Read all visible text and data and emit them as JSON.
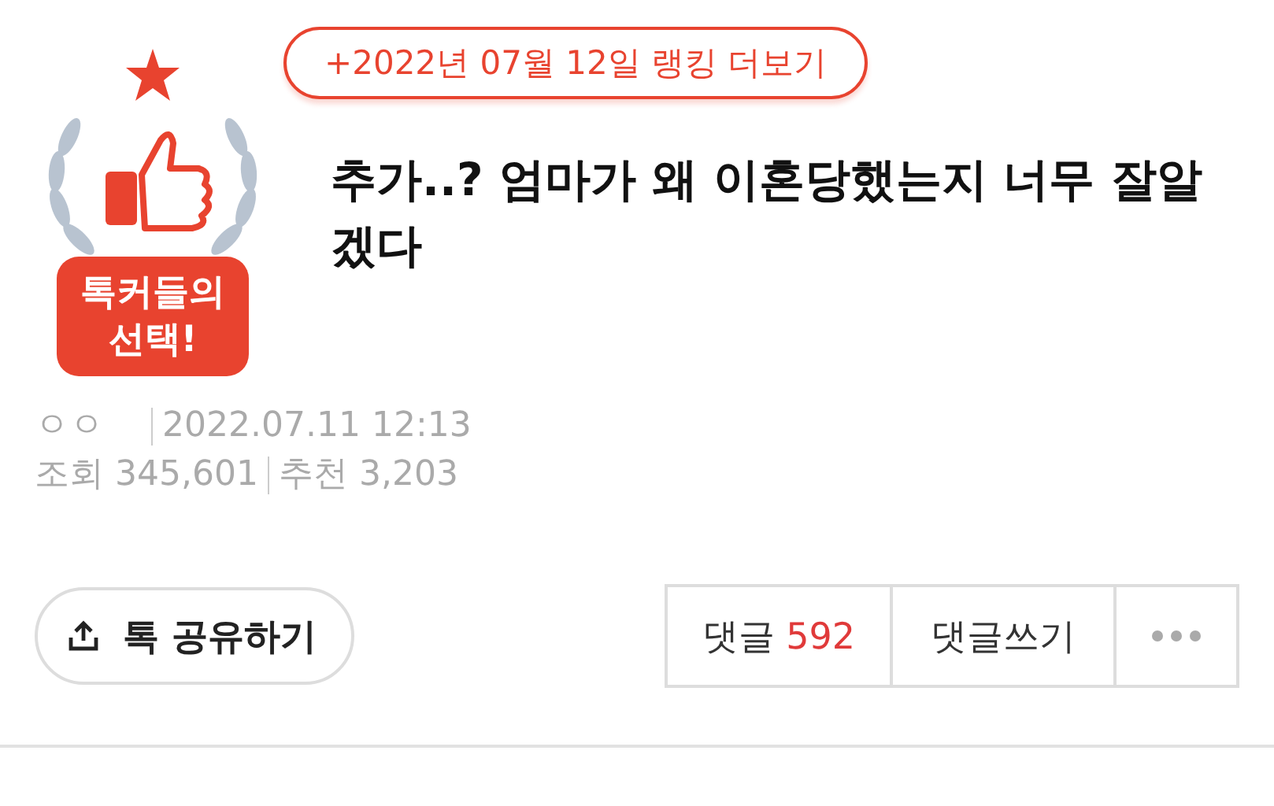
{
  "badge": {
    "label": "톡커들의 선택!"
  },
  "ranking_link": "+2022년 07월 12일 랭킹 더보기",
  "title": "추가..? 엄마가 왜 이혼당했는지 너무 잘알겠다",
  "meta": {
    "author": "ㅇㅇ",
    "date": "2022.07.11 12:13",
    "views_label": "조회",
    "views": "345,601",
    "likes_label": "추천",
    "likes": "3,203"
  },
  "share_button": "톡 공유하기",
  "comments": {
    "label": "댓글",
    "count": "592",
    "write": "댓글쓰기"
  }
}
